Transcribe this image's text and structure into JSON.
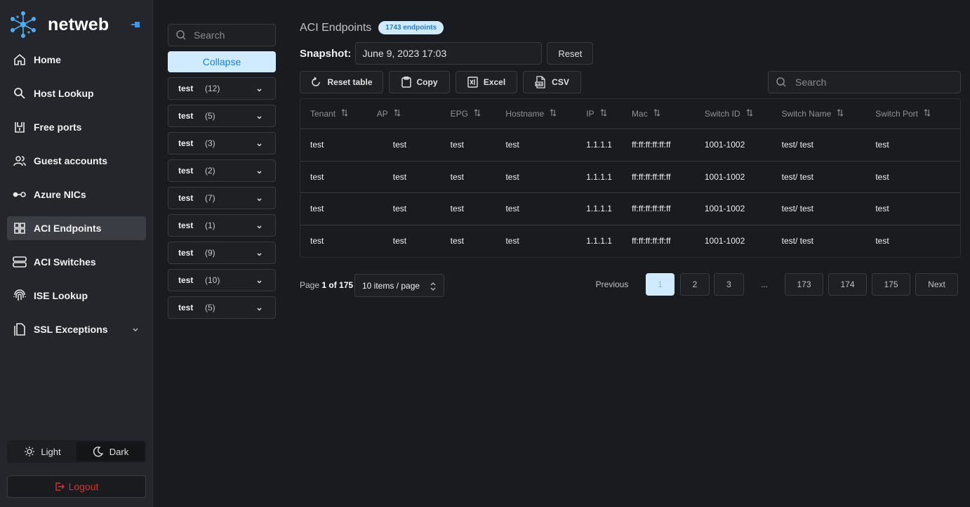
{
  "app": {
    "name": "netweb"
  },
  "sidebar": {
    "items": [
      {
        "label": "Home",
        "icon": "home-icon"
      },
      {
        "label": "Host Lookup",
        "icon": "search-icon"
      },
      {
        "label": "Free ports",
        "icon": "port-icon"
      },
      {
        "label": "Guest accounts",
        "icon": "users-icon"
      },
      {
        "label": "Azure NICs",
        "icon": "nic-icon"
      },
      {
        "label": "ACI Endpoints",
        "icon": "grid-icon",
        "active": true
      },
      {
        "label": "ACI Switches",
        "icon": "server-icon"
      },
      {
        "label": "ISE Lookup",
        "icon": "fingerprint-icon"
      },
      {
        "label": "SSL Exceptions",
        "icon": "copy-icon"
      }
    ],
    "theme": {
      "light": "Light",
      "dark": "Dark",
      "selected": "dark"
    },
    "logout": "Logout"
  },
  "filters": {
    "search_placeholder": "Search",
    "collapse_label": "Collapse",
    "groups": [
      {
        "name": "test",
        "count": "(12)"
      },
      {
        "name": "test",
        "count": "(5)"
      },
      {
        "name": "test",
        "count": "(3)"
      },
      {
        "name": "test",
        "count": "(2)"
      },
      {
        "name": "test",
        "count": "(7)"
      },
      {
        "name": "test",
        "count": "(1)"
      },
      {
        "name": "test",
        "count": "(9)"
      },
      {
        "name": "test",
        "count": "(10)"
      },
      {
        "name": "test",
        "count": "(5)"
      }
    ]
  },
  "main": {
    "title": "ACI Endpoints",
    "badge": "1743 endpoints",
    "snapshot_label": "Snapshot:",
    "snapshot_value": "June 9, 2023 17:03",
    "reset_label": "Reset",
    "toolbar": {
      "reset_table": "Reset table",
      "copy": "Copy",
      "excel": "Excel",
      "csv": "CSV",
      "search_placeholder": "Search"
    },
    "table": {
      "columns": [
        "Tenant",
        "AP",
        "EPG",
        "Hostname",
        "IP",
        "Mac",
        "Switch ID",
        "Switch Name",
        "Switch Port"
      ],
      "rows": [
        [
          "test",
          "test",
          "test",
          "test",
          "1.1.1.1",
          "ff:ff:ff:ff:ff:ff",
          "1001-1002",
          "test/ test",
          "test"
        ],
        [
          "test",
          "test",
          "test",
          "test",
          "1.1.1.1",
          "ff:ff:ff:ff:ff:ff",
          "1001-1002",
          "test/ test",
          "test"
        ],
        [
          "test",
          "test",
          "test",
          "test",
          "1.1.1.1",
          "ff:ff:ff:ff:ff:ff",
          "1001-1002",
          "test/ test",
          "test"
        ],
        [
          "test",
          "test",
          "test",
          "test",
          "1.1.1.1",
          "ff:ff:ff:ff:ff:ff",
          "1001-1002",
          "test/ test",
          "test"
        ]
      ]
    },
    "pagination": {
      "page_word": "Page",
      "page_of": "1 of 175",
      "per_page": "10 items / page",
      "previous": "Previous",
      "next": "Next",
      "pages": [
        "1",
        "2",
        "3",
        "...",
        "173",
        "174",
        "175"
      ],
      "current": "1"
    }
  },
  "colors": {
    "accent": "#1c7ed6",
    "accent_light": "#d0ebff",
    "danger": "#e03131",
    "bg": "#1a1b1e",
    "sidebar_bg": "#25262b"
  }
}
